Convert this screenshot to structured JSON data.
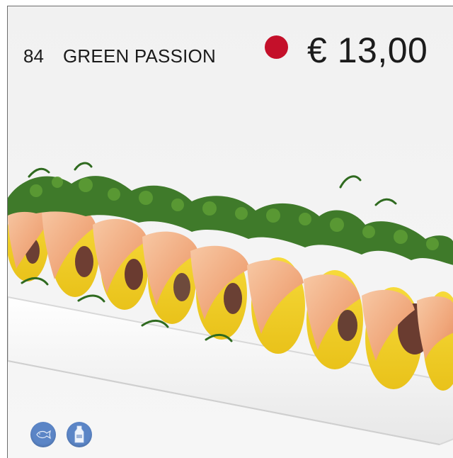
{
  "item": {
    "number": "84",
    "name": "GREEN PASSION",
    "price": "€ 13,00"
  },
  "indicator": {
    "color": "#c4102a"
  },
  "badges": [
    {
      "icon": "fish-icon",
      "color": "#5b85c6"
    },
    {
      "icon": "milk-icon",
      "color": "#5b85c6"
    }
  ]
}
